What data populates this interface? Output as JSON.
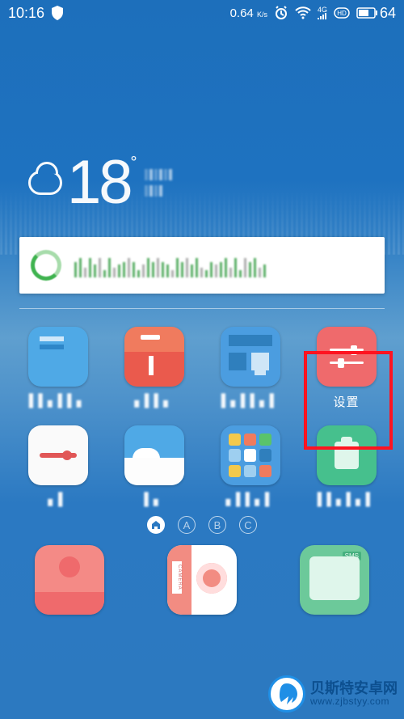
{
  "statusbar": {
    "time": "10:16",
    "net_speed_value": "0.64",
    "net_speed_unit": "K/s",
    "signal_label": "4G",
    "hd_label": "HD",
    "battery_percent": "64"
  },
  "weather": {
    "temperature": "18"
  },
  "apps_row1": [
    {
      "name": "app-blue1",
      "label": "▌▌▖▌▌▖"
    },
    {
      "name": "app-orange",
      "label": "▖▌▌▖"
    },
    {
      "name": "app-blue2",
      "label": "▌▖▌▌▖▌"
    },
    {
      "name": "app-settings",
      "label": "设置"
    }
  ],
  "apps_row2": [
    {
      "name": "app-white",
      "label": " ▖▌ "
    },
    {
      "name": "app-sky",
      "label": "▌▖"
    },
    {
      "name": "app-grid",
      "label": "▖▌▌▖▌"
    },
    {
      "name": "app-green",
      "label": "▌▌▖▌▖▌"
    }
  ],
  "pager": {
    "pages": [
      "home",
      "A",
      "B",
      "C"
    ],
    "active_index": 0
  },
  "dock": {
    "camera_tag": "CAMERA",
    "sms_tag": "SMS"
  },
  "watermark": {
    "title": "贝斯特安卓网",
    "url": "www.zjbstyy.com"
  }
}
